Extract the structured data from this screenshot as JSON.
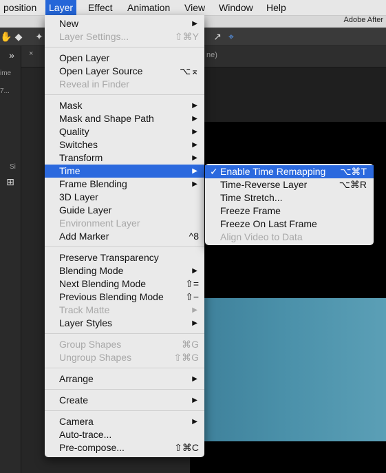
{
  "menubar": {
    "items": [
      "position",
      "Layer",
      "Effect",
      "Animation",
      "View",
      "Window",
      "Help"
    ],
    "active": "Layer"
  },
  "titlebar": {
    "title": "Adobe After"
  },
  "tab": {
    "close": "×",
    "partial_name": "ne)"
  },
  "left_panel": {
    "texts": [
      "ime",
      "7...",
      "Si"
    ]
  },
  "layer_menu": {
    "rows": [
      {
        "label": "New",
        "submenu": true
      },
      {
        "label": "Layer Settings...",
        "shortcut": "⇧⌘Y",
        "disabled": true
      },
      {
        "label": "Open Layer"
      },
      {
        "label": "Open Layer Source",
        "shortcut": "⌥⌅"
      },
      {
        "label": "Reveal in Finder",
        "disabled": true
      },
      {
        "label": "Mask",
        "submenu": true
      },
      {
        "label": "Mask and Shape Path",
        "submenu": true
      },
      {
        "label": "Quality",
        "submenu": true
      },
      {
        "label": "Switches",
        "submenu": true
      },
      {
        "label": "Transform",
        "submenu": true
      },
      {
        "label": "Time",
        "submenu": true,
        "highlighted": true
      },
      {
        "label": "Frame Blending",
        "submenu": true
      },
      {
        "label": "3D Layer"
      },
      {
        "label": "Guide Layer"
      },
      {
        "label": "Environment Layer",
        "disabled": true
      },
      {
        "label": "Add Marker",
        "shortcut": "^8"
      },
      {
        "label": "Preserve Transparency"
      },
      {
        "label": "Blending Mode",
        "submenu": true
      },
      {
        "label": "Next Blending Mode",
        "shortcut": "⇧="
      },
      {
        "label": "Previous Blending Mode",
        "shortcut": "⇧−"
      },
      {
        "label": "Track Matte",
        "submenu": true,
        "disabled": true
      },
      {
        "label": "Layer Styles",
        "submenu": true
      },
      {
        "label": "Group Shapes",
        "shortcut": "⌘G",
        "disabled": true
      },
      {
        "label": "Ungroup Shapes",
        "shortcut": "⇧⌘G",
        "disabled": true
      },
      {
        "label": "Arrange",
        "submenu": true
      },
      {
        "label": "Create",
        "submenu": true
      },
      {
        "label": "Camera",
        "submenu": true
      },
      {
        "label": "Auto-trace..."
      },
      {
        "label": "Pre-compose...",
        "shortcut": "⇧⌘C"
      }
    ]
  },
  "time_submenu": {
    "rows": [
      {
        "label": "Enable Time Remapping",
        "shortcut": "⌥⌘T",
        "checked": true,
        "highlighted": true
      },
      {
        "label": "Time-Reverse Layer",
        "shortcut": "⌥⌘R"
      },
      {
        "label": "Time Stretch..."
      },
      {
        "label": "Freeze Frame"
      },
      {
        "label": "Freeze On Last Frame"
      },
      {
        "label": "Align Video to Data",
        "disabled": true
      }
    ]
  },
  "colors": {
    "menu_bg": "#eaeaea",
    "highlight": "#2b69de",
    "viewer_blue": "#4b91aa"
  }
}
